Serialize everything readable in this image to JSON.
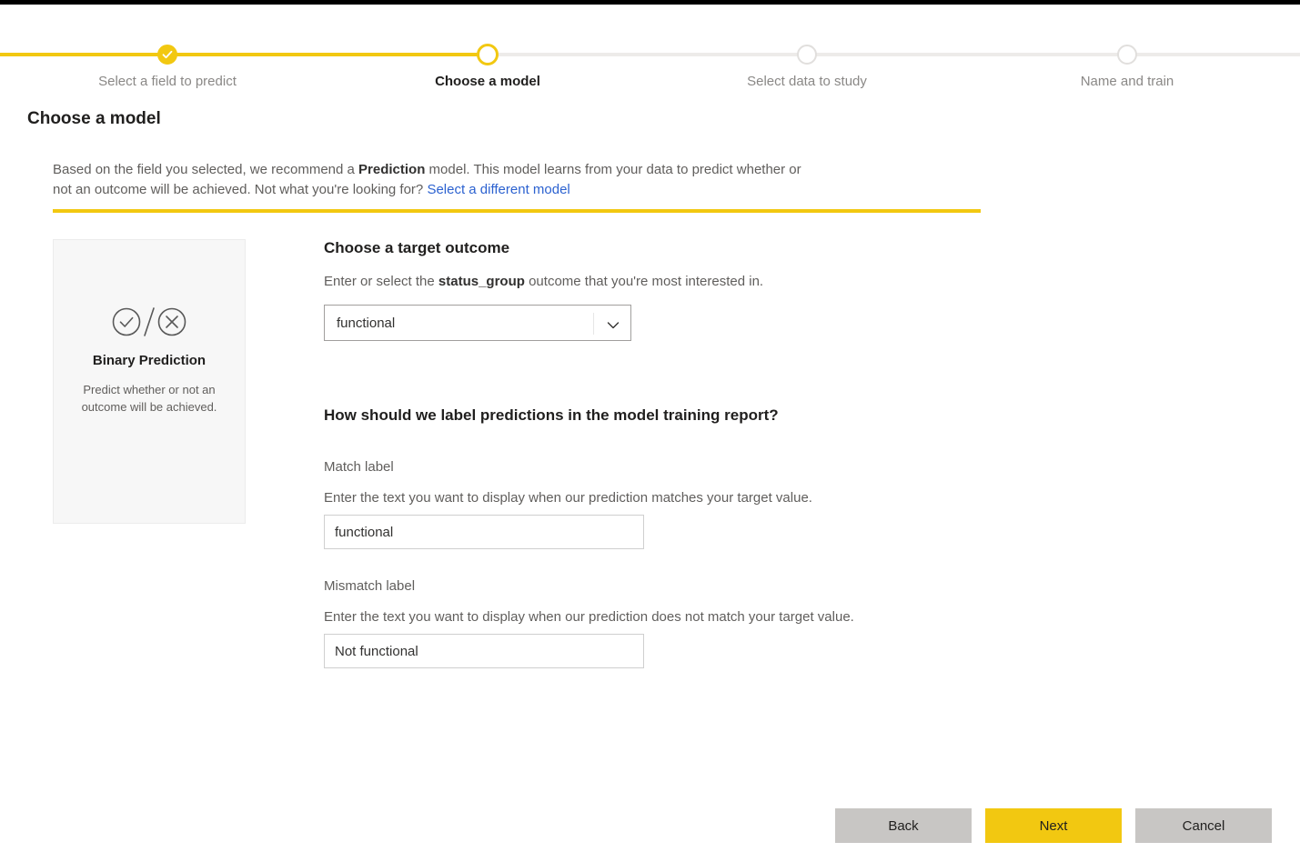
{
  "theme": {
    "accent": "#f2c811",
    "link": "#2c62d0",
    "track": "#edebe9",
    "button_secondary": "#c8c6c4",
    "card_bg": "#f7f7f7",
    "topbar": "#000000"
  },
  "stepper": {
    "steps": [
      {
        "label": "Select a field to predict",
        "state": "done"
      },
      {
        "label": "Choose a model",
        "state": "active"
      },
      {
        "label": "Select data to study",
        "state": "upcoming"
      },
      {
        "label": "Name and train",
        "state": "upcoming"
      }
    ]
  },
  "page": {
    "title": "Choose a model"
  },
  "intro": {
    "text_part1": "Based on the field you selected, we recommend a ",
    "emphasis": "Prediction",
    "text_part2": " model. This model learns from your data to predict whether or not an outcome will be achieved. Not what you're looking for? ",
    "link_label": "Select a different model"
  },
  "model_card": {
    "icon": "check-circle-slash-x-circle-icon",
    "title": "Binary Prediction",
    "description": "Predict whether or not an outcome will be achieved."
  },
  "target_outcome": {
    "heading": "Choose a target outcome",
    "description_part1": "Enter or select the ",
    "field_name": "status_group",
    "description_part2": " outcome that you're most interested in.",
    "selected_value": "functional",
    "chevron_icon": "chevron-down-icon"
  },
  "labels_section": {
    "heading": "How should we label predictions in the model training report?",
    "match": {
      "label": "Match label",
      "help": "Enter the text you want to display when our prediction matches your target value.",
      "value": "functional"
    },
    "mismatch": {
      "label": "Mismatch label",
      "help": "Enter the text you want to display when our prediction does not match your target value.",
      "value": "Not functional"
    }
  },
  "footer": {
    "back_label": "Back",
    "next_label": "Next",
    "cancel_label": "Cancel"
  }
}
